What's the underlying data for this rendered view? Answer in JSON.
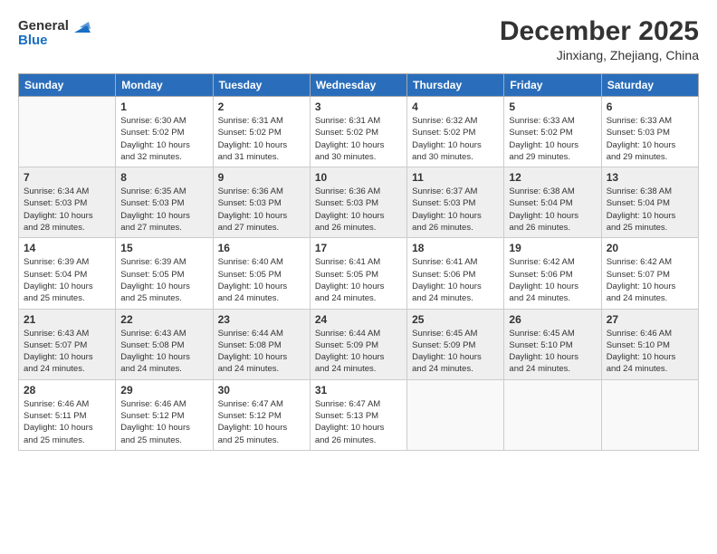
{
  "header": {
    "logo_line1": "General",
    "logo_line2": "Blue",
    "month": "December 2025",
    "location": "Jinxiang, Zhejiang, China"
  },
  "days_of_week": [
    "Sunday",
    "Monday",
    "Tuesday",
    "Wednesday",
    "Thursday",
    "Friday",
    "Saturday"
  ],
  "weeks": [
    [
      {
        "day": "",
        "info": ""
      },
      {
        "day": "1",
        "info": "Sunrise: 6:30 AM\nSunset: 5:02 PM\nDaylight: 10 hours\nand 32 minutes."
      },
      {
        "day": "2",
        "info": "Sunrise: 6:31 AM\nSunset: 5:02 PM\nDaylight: 10 hours\nand 31 minutes."
      },
      {
        "day": "3",
        "info": "Sunrise: 6:31 AM\nSunset: 5:02 PM\nDaylight: 10 hours\nand 30 minutes."
      },
      {
        "day": "4",
        "info": "Sunrise: 6:32 AM\nSunset: 5:02 PM\nDaylight: 10 hours\nand 30 minutes."
      },
      {
        "day": "5",
        "info": "Sunrise: 6:33 AM\nSunset: 5:02 PM\nDaylight: 10 hours\nand 29 minutes."
      },
      {
        "day": "6",
        "info": "Sunrise: 6:33 AM\nSunset: 5:03 PM\nDaylight: 10 hours\nand 29 minutes."
      }
    ],
    [
      {
        "day": "7",
        "info": "Sunrise: 6:34 AM\nSunset: 5:03 PM\nDaylight: 10 hours\nand 28 minutes."
      },
      {
        "day": "8",
        "info": "Sunrise: 6:35 AM\nSunset: 5:03 PM\nDaylight: 10 hours\nand 27 minutes."
      },
      {
        "day": "9",
        "info": "Sunrise: 6:36 AM\nSunset: 5:03 PM\nDaylight: 10 hours\nand 27 minutes."
      },
      {
        "day": "10",
        "info": "Sunrise: 6:36 AM\nSunset: 5:03 PM\nDaylight: 10 hours\nand 26 minutes."
      },
      {
        "day": "11",
        "info": "Sunrise: 6:37 AM\nSunset: 5:03 PM\nDaylight: 10 hours\nand 26 minutes."
      },
      {
        "day": "12",
        "info": "Sunrise: 6:38 AM\nSunset: 5:04 PM\nDaylight: 10 hours\nand 26 minutes."
      },
      {
        "day": "13",
        "info": "Sunrise: 6:38 AM\nSunset: 5:04 PM\nDaylight: 10 hours\nand 25 minutes."
      }
    ],
    [
      {
        "day": "14",
        "info": "Sunrise: 6:39 AM\nSunset: 5:04 PM\nDaylight: 10 hours\nand 25 minutes."
      },
      {
        "day": "15",
        "info": "Sunrise: 6:39 AM\nSunset: 5:05 PM\nDaylight: 10 hours\nand 25 minutes."
      },
      {
        "day": "16",
        "info": "Sunrise: 6:40 AM\nSunset: 5:05 PM\nDaylight: 10 hours\nand 24 minutes."
      },
      {
        "day": "17",
        "info": "Sunrise: 6:41 AM\nSunset: 5:05 PM\nDaylight: 10 hours\nand 24 minutes."
      },
      {
        "day": "18",
        "info": "Sunrise: 6:41 AM\nSunset: 5:06 PM\nDaylight: 10 hours\nand 24 minutes."
      },
      {
        "day": "19",
        "info": "Sunrise: 6:42 AM\nSunset: 5:06 PM\nDaylight: 10 hours\nand 24 minutes."
      },
      {
        "day": "20",
        "info": "Sunrise: 6:42 AM\nSunset: 5:07 PM\nDaylight: 10 hours\nand 24 minutes."
      }
    ],
    [
      {
        "day": "21",
        "info": "Sunrise: 6:43 AM\nSunset: 5:07 PM\nDaylight: 10 hours\nand 24 minutes."
      },
      {
        "day": "22",
        "info": "Sunrise: 6:43 AM\nSunset: 5:08 PM\nDaylight: 10 hours\nand 24 minutes."
      },
      {
        "day": "23",
        "info": "Sunrise: 6:44 AM\nSunset: 5:08 PM\nDaylight: 10 hours\nand 24 minutes."
      },
      {
        "day": "24",
        "info": "Sunrise: 6:44 AM\nSunset: 5:09 PM\nDaylight: 10 hours\nand 24 minutes."
      },
      {
        "day": "25",
        "info": "Sunrise: 6:45 AM\nSunset: 5:09 PM\nDaylight: 10 hours\nand 24 minutes."
      },
      {
        "day": "26",
        "info": "Sunrise: 6:45 AM\nSunset: 5:10 PM\nDaylight: 10 hours\nand 24 minutes."
      },
      {
        "day": "27",
        "info": "Sunrise: 6:46 AM\nSunset: 5:10 PM\nDaylight: 10 hours\nand 24 minutes."
      }
    ],
    [
      {
        "day": "28",
        "info": "Sunrise: 6:46 AM\nSunset: 5:11 PM\nDaylight: 10 hours\nand 25 minutes."
      },
      {
        "day": "29",
        "info": "Sunrise: 6:46 AM\nSunset: 5:12 PM\nDaylight: 10 hours\nand 25 minutes."
      },
      {
        "day": "30",
        "info": "Sunrise: 6:47 AM\nSunset: 5:12 PM\nDaylight: 10 hours\nand 25 minutes."
      },
      {
        "day": "31",
        "info": "Sunrise: 6:47 AM\nSunset: 5:13 PM\nDaylight: 10 hours\nand 26 minutes."
      },
      {
        "day": "",
        "info": ""
      },
      {
        "day": "",
        "info": ""
      },
      {
        "day": "",
        "info": ""
      }
    ]
  ]
}
